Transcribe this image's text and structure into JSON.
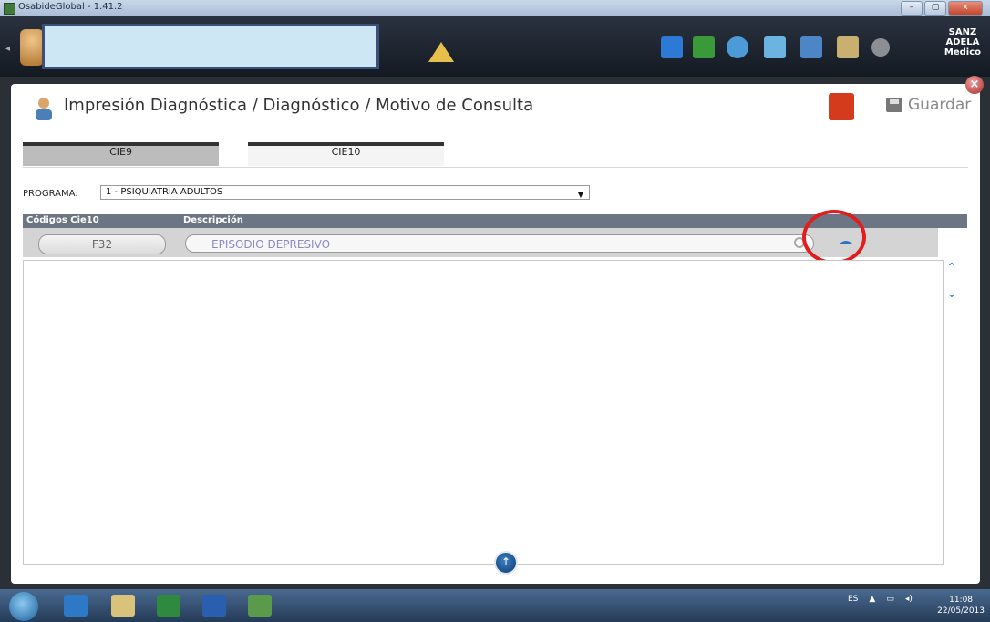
{
  "window": {
    "title": "OsabideGlobal - 1.41.2",
    "controls": [
      "–",
      "▢",
      "x"
    ]
  },
  "appbar": {
    "user": {
      "line1": "SANZ",
      "line2": "ADELA",
      "line3": "Medico"
    }
  },
  "panel": {
    "title": "Impresión Diagnóstica / Diagnóstico / Motivo de Consulta",
    "save_label": "Guardar",
    "tabs": [
      {
        "label": "CIE9"
      },
      {
        "label": "CIE10"
      }
    ],
    "programa": {
      "label": "PROGRAMA:",
      "value": "1 - PSIQUIATRIA ADULTOS"
    },
    "grid": {
      "columns": [
        "Códigos Cie10",
        "Descripción"
      ],
      "edit_row": {
        "code": "F32",
        "description": "EPISODIO DEPRESIVO"
      }
    }
  },
  "taskbar": {
    "lang": "ES",
    "clock_time": "11:08",
    "clock_date": "22/05/2013"
  },
  "colors": {
    "accent_blue": "#3b79c2",
    "highlight_red": "#e11d1d",
    "header_gray": "#6b7583"
  }
}
